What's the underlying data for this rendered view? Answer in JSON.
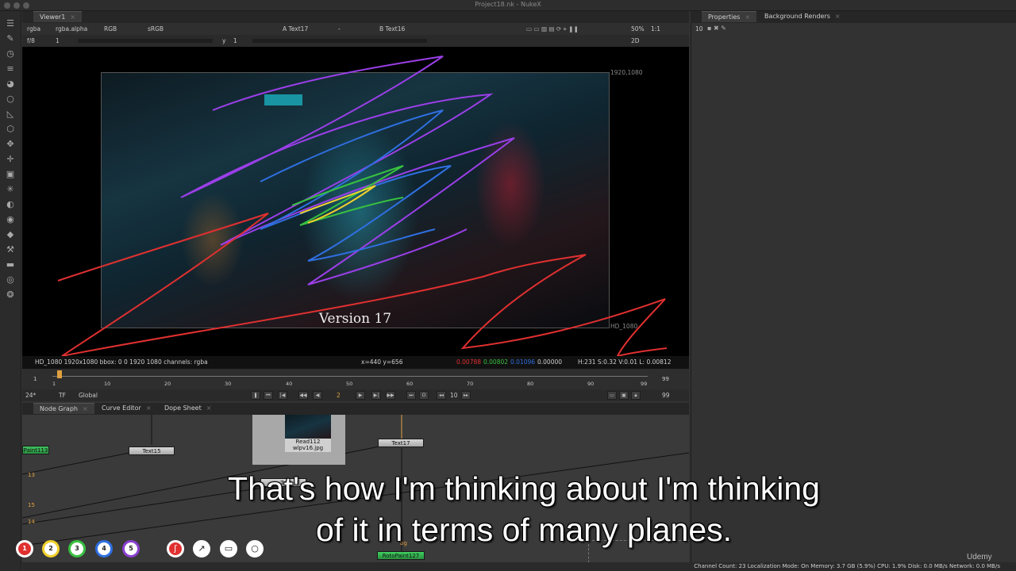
{
  "window": {
    "title": "Project18.nk - NukeX"
  },
  "toolbar": {
    "icons": [
      "menu-icon",
      "pen-icon",
      "clock-icon",
      "channels-icon",
      "color-icon",
      "circle-icon",
      "filter-icon",
      "keyer-icon",
      "merge-icon",
      "transform-icon",
      "3d-icon",
      "particles-icon",
      "deep-icon",
      "view-icon",
      "toolsets-icon",
      "other-icon",
      "furnace-icon",
      "ocula-icon",
      "metadata-icon"
    ]
  },
  "viewer": {
    "tab_label": "Viewer1",
    "bar1": {
      "channels": "rgba",
      "alpha": "rgba.alpha",
      "colorspace": "RGB",
      "lut": "sRGB",
      "input_a": "A  Text17",
      "input_a_op": "-",
      "input_b": "B  Text16",
      "zoom": "50%",
      "ratio": "1:1"
    },
    "bar2": {
      "fstop": "f/8",
      "gain": "1",
      "gamma_label": "y",
      "gamma": "1",
      "view_mode": "2D"
    },
    "overlay_text": "Version 17",
    "res_top": "1920,1080",
    "res_bottom": "HD_1080",
    "info": {
      "format": "HD_1080 1920x1080  bbox: 0 0 1920 1080 channels: rgba",
      "coords": "x=440 y=656",
      "r": "0.00788",
      "g": "0.00802",
      "b": "0.01096",
      "a": "0.00000",
      "hsv": "H:231 S:0.32 V:0.01  L: 0.00812"
    }
  },
  "timeline": {
    "start": "1",
    "end": "99",
    "ticks": [
      "1",
      "10",
      "20",
      "30",
      "40",
      "50",
      "60",
      "70",
      "80",
      "90",
      "99"
    ],
    "end_frame": "99"
  },
  "playbar": {
    "fps": "24*",
    "tf": "TF",
    "scope": "Global",
    "current_frame": "2",
    "step": "10",
    "end_frame": "99"
  },
  "nodegraph": {
    "tabs": [
      {
        "label": "Node Graph"
      },
      {
        "label": "Curve Editor"
      },
      {
        "label": "Dope Sheet"
      }
    ],
    "nodes": {
      "paint": "Paint113",
      "text15": "Text15",
      "read": "Read112",
      "read_file": "wlpv16.jpg",
      "text17": "Text17",
      "text_hidden": "Te",
      "roto": "RotoPaint127",
      "bg": "bg"
    },
    "labels": {
      "l13": "13",
      "l15": "15",
      "l14": "14"
    }
  },
  "properties": {
    "tabs": [
      {
        "label": "Properties"
      },
      {
        "label": "Background Renders"
      }
    ],
    "max_panels": "10"
  },
  "status": "Channel Count: 23  Localization Mode: On  Memory: 3.7 GB (5.9%)  CPU: 1.9%  Disk: 0.0 MB/s  Network: 0.0 MB/s",
  "subtitles": {
    "line1": "That's how I'm thinking about I'm thinking",
    "line2": "of it in terms of many planes."
  },
  "annotation_tools": {
    "colors": [
      {
        "label": "1",
        "color": "#e03030"
      },
      {
        "label": "2",
        "color": "#f2d02a"
      },
      {
        "label": "3",
        "color": "#38c040"
      },
      {
        "label": "4",
        "color": "#2f6fe0"
      },
      {
        "label": "5",
        "color": "#8a3fd0"
      }
    ]
  },
  "watermark": "Udemy"
}
